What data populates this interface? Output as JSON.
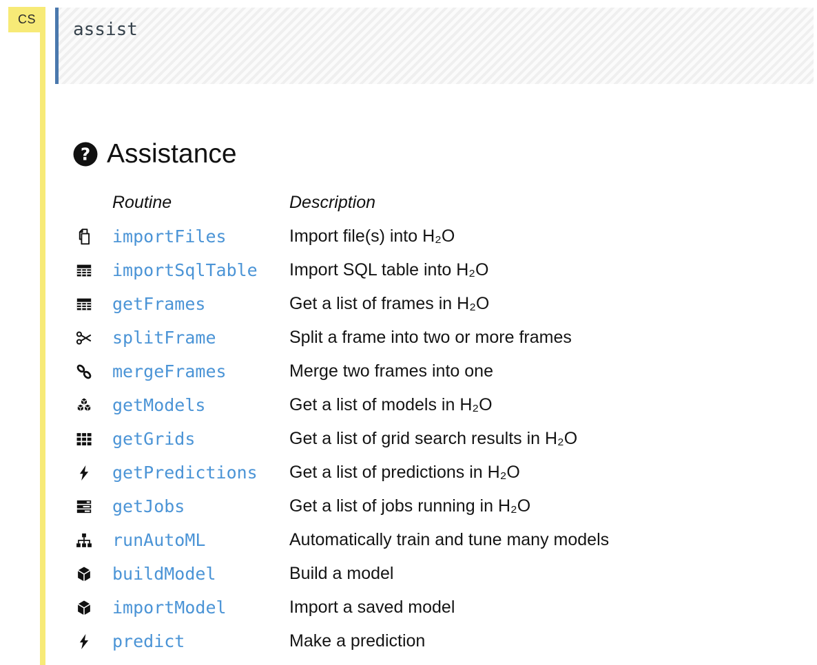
{
  "cell": {
    "type_badge": "CS",
    "code": "assist"
  },
  "output": {
    "title": "Assistance",
    "title_icon": "question-circle-icon",
    "table": {
      "columns": {
        "routine": "Routine",
        "description": "Description"
      },
      "rows": [
        {
          "icon": "files-icon",
          "routine": "importFiles",
          "description": "Import file(s) into H₂O"
        },
        {
          "icon": "table-icon",
          "routine": "importSqlTable",
          "description": "Import SQL table into H₂O"
        },
        {
          "icon": "table-icon",
          "routine": "getFrames",
          "description": "Get a list of frames in H₂O"
        },
        {
          "icon": "scissors-icon",
          "routine": "splitFrame",
          "description": "Split a frame into two or more frames"
        },
        {
          "icon": "link-icon",
          "routine": "mergeFrames",
          "description": "Merge two frames into one"
        },
        {
          "icon": "cubes-icon",
          "routine": "getModels",
          "description": "Get a list of models in H₂O"
        },
        {
          "icon": "grid-icon",
          "routine": "getGrids",
          "description": "Get a list of grid search results in H₂O"
        },
        {
          "icon": "bolt-icon",
          "routine": "getPredictions",
          "description": "Get a list of predictions in H₂O"
        },
        {
          "icon": "tasks-icon",
          "routine": "getJobs",
          "description": "Get a list of jobs running in H₂O"
        },
        {
          "icon": "sitemap-icon",
          "routine": "runAutoML",
          "description": "Automatically train and tune many models"
        },
        {
          "icon": "cube-icon",
          "routine": "buildModel",
          "description": "Build a model"
        },
        {
          "icon": "cube-icon",
          "routine": "importModel",
          "description": "Import a saved model"
        },
        {
          "icon": "bolt-icon",
          "routine": "predict",
          "description": "Make a prediction"
        }
      ]
    }
  },
  "colors": {
    "accent_yellow": "#f7ea77",
    "code_border_blue": "#4a78ad",
    "link_blue": "#4b94d6",
    "icon_black": "#111111"
  }
}
